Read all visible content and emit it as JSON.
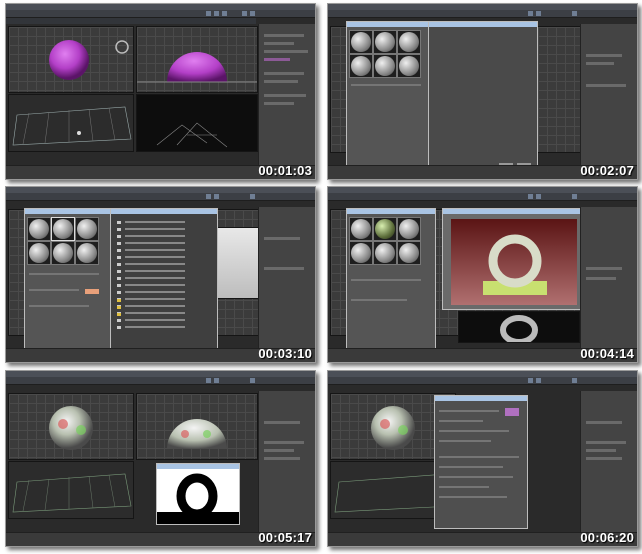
{
  "thumbnails": [
    {
      "timecode": "00:01:03"
    },
    {
      "timecode": "00:02:07"
    },
    {
      "timecode": "00:03:10"
    },
    {
      "timecode": "00:04:14"
    },
    {
      "timecode": "00:05:17"
    },
    {
      "timecode": "00:06:20"
    }
  ],
  "colors": {
    "sphere_purple": "#b33fc7",
    "viewport_grey": "#3b3b3b",
    "dialog_grey": "#555555",
    "render_red": "#7a1f1f",
    "render_ground": "#c8e070"
  },
  "icons": [
    "sphere-icon",
    "dome-icon",
    "teapot-ring-icon",
    "material-slot-icon"
  ]
}
